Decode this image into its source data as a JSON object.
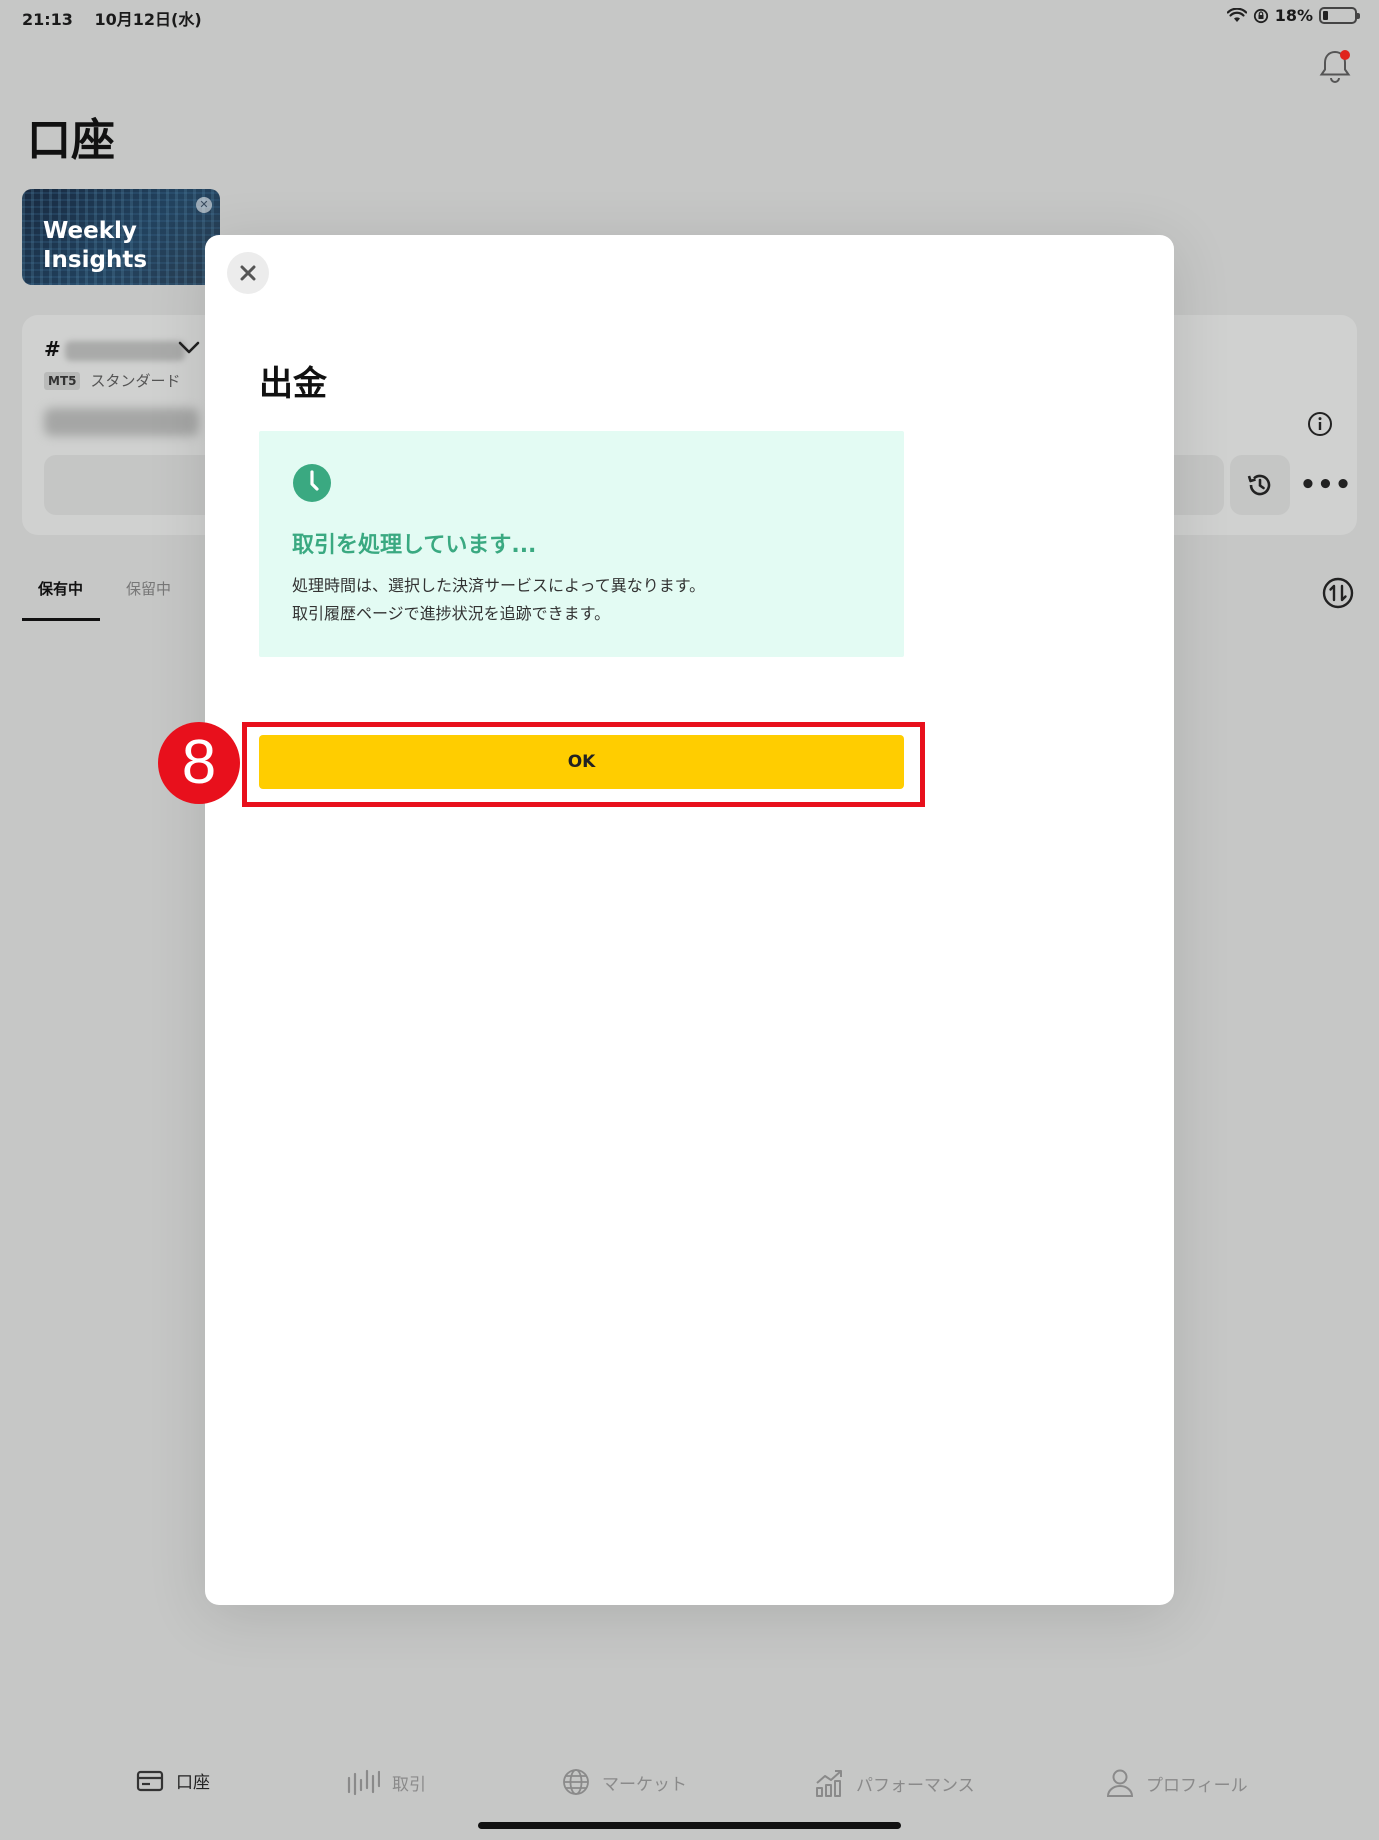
{
  "status_bar": {
    "time": "21:13",
    "date": "10月12日(水)",
    "battery": "18%"
  },
  "page": {
    "title": "口座",
    "promo": {
      "text": "Weekly\nInsights"
    },
    "account": {
      "number_prefix": "#",
      "platform_badge": "MT5",
      "account_type": "スタンダード"
    },
    "tabs": [
      {
        "label": "保有中",
        "active": true
      },
      {
        "label": "保留中",
        "active": false
      }
    ]
  },
  "bottom_nav": [
    {
      "label": "口座",
      "icon": "card-icon",
      "active": true
    },
    {
      "label": "取引",
      "icon": "candlestick-icon",
      "active": false
    },
    {
      "label": "マーケット",
      "icon": "globe-icon",
      "active": false
    },
    {
      "label": "パフォーマンス",
      "icon": "chart-icon",
      "active": false
    },
    {
      "label": "プロフィール",
      "icon": "person-icon",
      "active": false
    }
  ],
  "modal": {
    "title": "出金",
    "status": {
      "heading": "取引を処理しています...",
      "line1": "処理時間は、選択した決済サービスによって異なります。",
      "line2": "取引履歴ページで進捗状況を追跡できます。"
    },
    "ok_label": "OK"
  },
  "annotation": {
    "step_number": "8"
  },
  "colors": {
    "accent_yellow": "#ffcd00",
    "status_green": "#3aa981",
    "info_bg": "#e3fbf3",
    "highlight_red": "#e8101c"
  }
}
